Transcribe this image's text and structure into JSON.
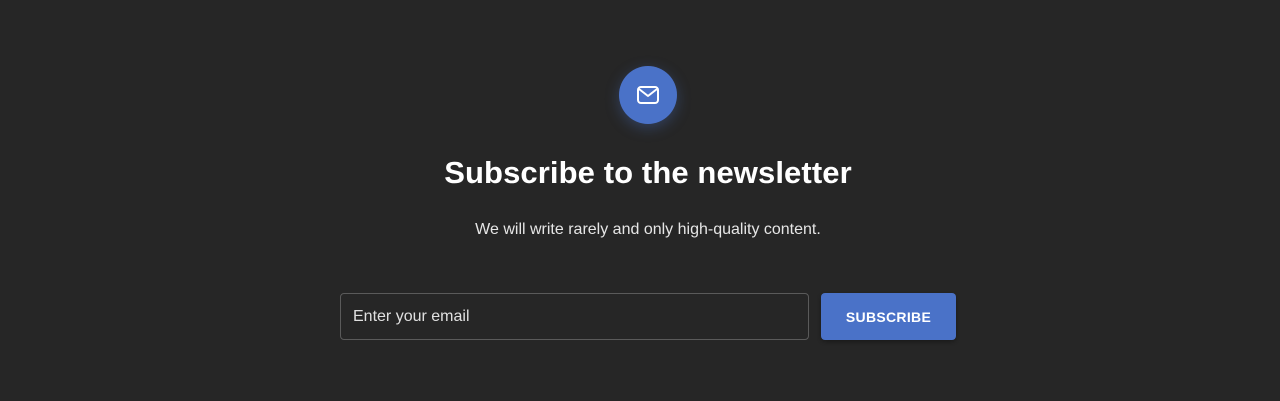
{
  "newsletter": {
    "icon": "envelope-icon",
    "title": "Subscribe to the newsletter",
    "subtitle": "We will write rarely and only high-quality content.",
    "email_placeholder": "Enter your email",
    "email_value": "",
    "subscribe_label": "SUBSCRIBE"
  },
  "colors": {
    "background": "#262626",
    "accent": "#4a72c8",
    "text": "#ffffff",
    "input_border": "#5a5a5a"
  }
}
